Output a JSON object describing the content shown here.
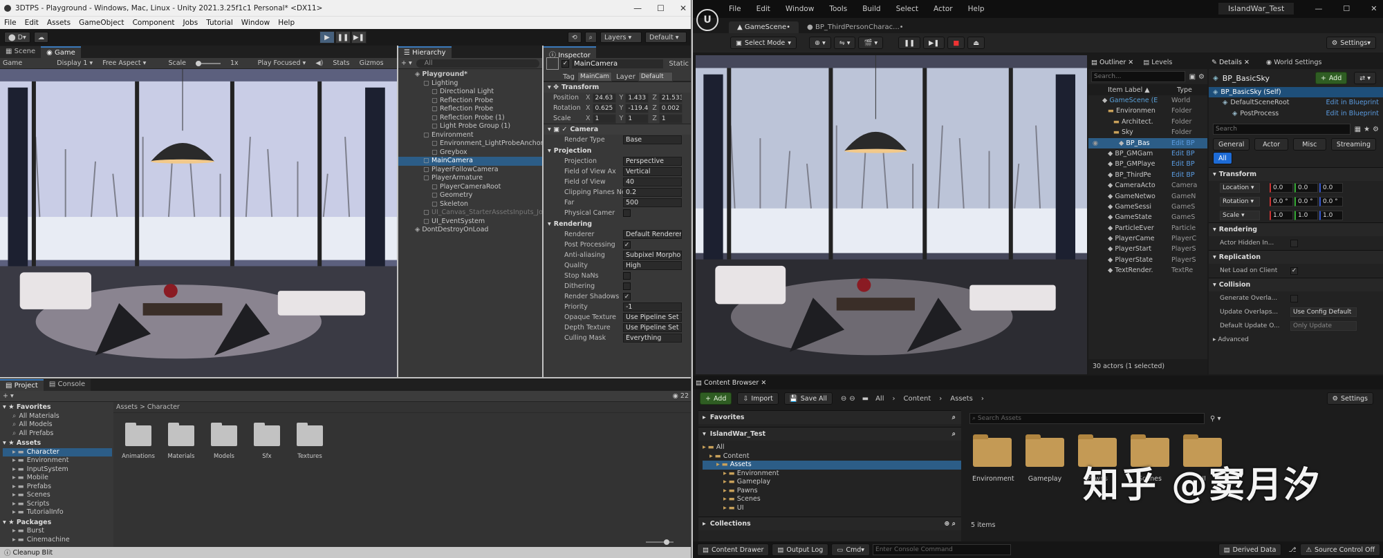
{
  "unity": {
    "title": "3DTPS - Playground - Windows, Mac, Linux - Unity 2021.3.25f1c1 Personal* <DX11>",
    "menu": [
      "File",
      "Edit",
      "Assets",
      "GameObject",
      "Component",
      "Jobs",
      "Tutorial",
      "Window",
      "Help"
    ],
    "account": "D",
    "layers": "Layers",
    "layout": "Default",
    "scene_tabs": [
      "Scene",
      "Game"
    ],
    "game_bar": {
      "mode": "Game",
      "display": "Display 1",
      "aspect": "Free Aspect",
      "scale_label": "Scale",
      "scale_val": "1x",
      "focus": "Play Focused",
      "stats": "Stats",
      "gizmos": "Gizmos"
    },
    "hierarchy": {
      "tab": "Hierarchy",
      "search": "All",
      "items": [
        {
          "t": "Playground*",
          "d": 0,
          "b": true
        },
        {
          "t": "Lighting",
          "d": 1
        },
        {
          "t": "Directional Light",
          "d": 2
        },
        {
          "t": "Reflection Probe",
          "d": 2
        },
        {
          "t": "Reflection Probe",
          "d": 2
        },
        {
          "t": "Reflection Probe (1)",
          "d": 2
        },
        {
          "t": "Light Probe Group (1)",
          "d": 2
        },
        {
          "t": "Environment",
          "d": 1
        },
        {
          "t": "Environment_LightProbeAnchor",
          "d": 2
        },
        {
          "t": "Greybox",
          "d": 2
        },
        {
          "t": "MainCamera",
          "d": 1,
          "s": true
        },
        {
          "t": "PlayerFollowCamera",
          "d": 1
        },
        {
          "t": "PlayerArmature",
          "d": 1
        },
        {
          "t": "PlayerCameraRoot",
          "d": 2
        },
        {
          "t": "Geometry",
          "d": 2
        },
        {
          "t": "Skeleton",
          "d": 2
        },
        {
          "t": "UI_Canvas_StarterAssetsInputs_Joy",
          "d": 1,
          "g": true
        },
        {
          "t": "UI_EventSystem",
          "d": 1
        },
        {
          "t": "DontDestroyOnLoad",
          "d": 0
        }
      ]
    },
    "inspector": {
      "tab": "Inspector",
      "name": "MainCamera",
      "static": "Static",
      "tag_label": "Tag",
      "tag": "MainCam",
      "layer_label": "Layer",
      "layer": "Default",
      "transform": "Transform",
      "position": {
        "label": "Position",
        "x": "24.63",
        "y": "1.433",
        "z": "21.533"
      },
      "rotation": {
        "label": "Rotation",
        "x": "0.625",
        "y": "-119.4",
        "z": "0.002"
      },
      "scale": {
        "label": "Scale",
        "x": "1",
        "y": "1",
        "z": "1"
      },
      "camera": "Camera",
      "props1": [
        {
          "k": "Render Type",
          "v": "Base"
        }
      ],
      "projection": "Projection",
      "props2": [
        {
          "k": "Projection",
          "v": "Perspective"
        },
        {
          "k": "Field of View Ax",
          "v": "Vertical"
        },
        {
          "k": "Field of View",
          "v": "40"
        },
        {
          "k": "Clipping Planes Near",
          "v": "0.2"
        },
        {
          "k": "Far",
          "v": "500"
        },
        {
          "k": "Physical Camer",
          "v": ""
        }
      ],
      "rendering": "Rendering",
      "props3": [
        {
          "k": "Renderer",
          "v": "Default Renderer"
        },
        {
          "k": "Post Processing",
          "v": "✓"
        },
        {
          "k": "Anti-aliasing",
          "v": "Subpixel Morpho"
        },
        {
          "k": "Quality",
          "v": "High"
        },
        {
          "k": "Stop NaNs",
          "v": ""
        },
        {
          "k": "Dithering",
          "v": ""
        },
        {
          "k": "Render Shadows",
          "v": "✓"
        },
        {
          "k": "Priority",
          "v": "-1"
        },
        {
          "k": "Opaque Texture",
          "v": "Use Pipeline Set"
        },
        {
          "k": "Depth Texture",
          "v": "Use Pipeline Set"
        },
        {
          "k": "Culling Mask",
          "v": "Everything"
        }
      ]
    },
    "project": {
      "tabs": [
        "Project",
        "Console"
      ],
      "count": "22",
      "favorites": "Favorites",
      "fav_items": [
        "All Materials",
        "All Models",
        "All Prefabs"
      ],
      "assets": "Assets",
      "asset_items": [
        "Character",
        "Environment",
        "InputSystem",
        "Mobile",
        "Prefabs",
        "Scenes",
        "Scripts",
        "TutorialInfo"
      ],
      "packages": "Packages",
      "pkg_items": [
        "Burst",
        "Cinemachine"
      ],
      "breadcrumb": [
        "Assets",
        "Character"
      ],
      "folders": [
        "Animations",
        "Materials",
        "Models",
        "Sfx",
        "Textures"
      ]
    },
    "status": "Cleanup Blit"
  },
  "unreal": {
    "menu": [
      "File",
      "Edit",
      "Window",
      "Tools",
      "Build",
      "Select",
      "Actor",
      "Help"
    ],
    "project": "IslandWar_Test",
    "tabs": [
      "GameScene•",
      "BP_ThirdPersonCharac...•"
    ],
    "select_mode": "Select Mode",
    "settings": "Settings",
    "outliner": {
      "tab": "Outliner",
      "tab2": "Levels",
      "search": "Search...",
      "col1": "Item Label ▲",
      "col2": "Type",
      "items": [
        {
          "t": "GameScene (E",
          "y": "World",
          "d": 0,
          "c": "#5aa0d8"
        },
        {
          "t": "Environmen",
          "y": "Folder",
          "d": 1
        },
        {
          "t": "Architect.",
          "y": "Folder",
          "d": 2
        },
        {
          "t": "Sky",
          "y": "Folder",
          "d": 2
        },
        {
          "t": "BP_Bas",
          "y": "Edit BP",
          "d": 3,
          "s": true
        },
        {
          "t": "BP_GMGam",
          "y": "Edit BP",
          "d": 1
        },
        {
          "t": "BP_GMPlaye",
          "y": "Edit BP",
          "d": 1
        },
        {
          "t": "BP_ThirdPe",
          "y": "Edit BP",
          "d": 1
        },
        {
          "t": "CameraActo",
          "y": "Camera",
          "d": 1
        },
        {
          "t": "GameNetwo",
          "y": "GameN",
          "d": 1
        },
        {
          "t": "GameSessi",
          "y": "GameS",
          "d": 1
        },
        {
          "t": "GameState",
          "y": "GameS",
          "d": 1
        },
        {
          "t": "ParticleEver",
          "y": "Particle",
          "d": 1
        },
        {
          "t": "PlayerCame",
          "y": "PlayerC",
          "d": 1
        },
        {
          "t": "PlayerStart",
          "y": "PlayerS",
          "d": 1
        },
        {
          "t": "PlayerState",
          "y": "PlayerS",
          "d": 1
        },
        {
          "t": "TextRender.",
          "y": "TextRe",
          "d": 1
        }
      ],
      "footer": "30 actors (1 selected)"
    },
    "details": {
      "tab": "Details",
      "tab2": "World Settings",
      "name": "BP_BasicSky",
      "add": "Add",
      "comps": [
        {
          "t": "BP_BasicSky (Self)",
          "e": ""
        },
        {
          "t": "DefaultSceneRoot",
          "e": "Edit in Blueprint"
        },
        {
          "t": "PostProcess",
          "e": "Edit in Blueprint"
        }
      ],
      "search": "Search",
      "filters": [
        "General",
        "Actor",
        "Misc",
        "Streaming"
      ],
      "all": "All",
      "transform": "Transform",
      "location": {
        "label": "Location",
        "x": "0.0",
        "y": "0.0",
        "z": "0.0"
      },
      "rotation": {
        "label": "Rotation",
        "x": "0.0 °",
        "y": "0.0 °",
        "z": "0.0 °"
      },
      "scale": {
        "label": "Scale",
        "x": "1.0",
        "y": "1.0",
        "z": "1.0"
      },
      "rendering": "Rendering",
      "hidden": "Actor Hidden In...",
      "replication": "Replication",
      "netload": "Net Load on Client",
      "collision": "Collision",
      "genoverlap": "Generate Overla...",
      "updateoverlaps": "Update Overlaps...",
      "updateoverlaps_v": "Use Config Default",
      "defaultupdate": "Default Update O...",
      "defaultupdate_v": "Only Update Movabl",
      "advanced": "Advanced"
    },
    "content": {
      "tab": "Content Browser",
      "add": "Add",
      "import": "Import",
      "save": "Save All",
      "crumbs": [
        "All",
        "Content",
        "Assets"
      ],
      "settings": "Settings",
      "favorites": "Favorites",
      "project": "IslandWar_Test",
      "tree": [
        {
          "t": "All",
          "d": 0
        },
        {
          "t": "Content",
          "d": 1
        },
        {
          "t": "Assets",
          "d": 2,
          "s": true
        },
        {
          "t": "Environment",
          "d": 3
        },
        {
          "t": "Gameplay",
          "d": 3
        },
        {
          "t": "Pawns",
          "d": 3
        },
        {
          "t": "Scenes",
          "d": 3
        },
        {
          "t": "UI",
          "d": 3
        }
      ],
      "collections": "Collections",
      "search": "Search Assets",
      "folders": [
        "Environment",
        "Gameplay",
        "Pawns",
        "Scenes",
        "UI"
      ],
      "count": "5 items"
    },
    "bottom": {
      "drawer": "Content Drawer",
      "log": "Output Log",
      "cmd": "Cmd",
      "cmd_ph": "Enter Console Command",
      "derived": "Derived Data",
      "source": "Source Control Off"
    }
  },
  "watermark": "知乎 @窦月汐"
}
